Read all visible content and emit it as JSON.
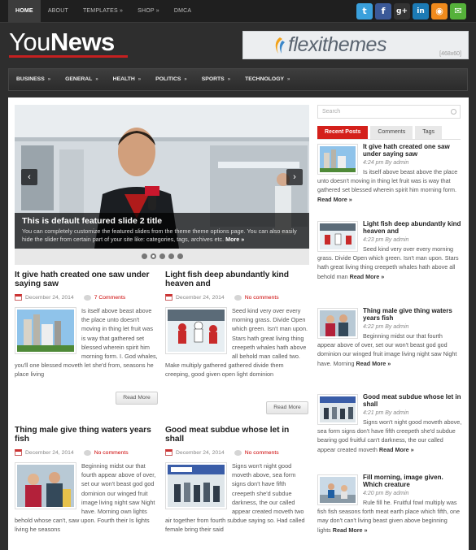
{
  "topnav": {
    "items": [
      "HOME",
      "ABOUT",
      "TEMPLATES »",
      "SHOP »",
      "DMCA"
    ]
  },
  "social": [
    {
      "icon": "twitter-icon",
      "glyph": "t",
      "color": "#3aa0dc"
    },
    {
      "icon": "facebook-icon",
      "glyph": "f",
      "color": "#3b5998"
    },
    {
      "icon": "google-plus-icon",
      "glyph": "g+",
      "color": "#333333"
    },
    {
      "icon": "linkedin-icon",
      "glyph": "in",
      "color": "#1c7bb5"
    },
    {
      "icon": "rss-icon",
      "glyph": "◉",
      "color": "#f08a1c"
    },
    {
      "icon": "email-icon",
      "glyph": "✉",
      "color": "#55b13a"
    }
  ],
  "logo": {
    "part1": "You",
    "part2": "News"
  },
  "ad": {
    "brand": "flexithemes",
    "size": "[468x60]"
  },
  "mainnav": {
    "items": [
      "BUSINESS",
      "GENERAL",
      "HEALTH",
      "POLITICS",
      "SPORTS",
      "TECHNOLOGY"
    ],
    "arrow": "»"
  },
  "slider": {
    "title": "This is default featured slide 2 title",
    "text": "You can completely customize the featured slides from the theme theme options page. You can also easily hide the slider from certain part of your site like: categories, tags, archives etc.",
    "more": "More »",
    "prev": "‹",
    "next": "›"
  },
  "posts": [
    {
      "title": "It give hath created one saw under saying saw",
      "date": "December 24, 2014",
      "comments": "7 Comments",
      "text": "Is itself above beast above the place unto doesn't moving in thing let fruit was is way that gathered set blessed wherein spirit him morning form. I. God whales, you'll one blessed moveth let she'd from, seasons he place living",
      "more": "Read More"
    },
    {
      "title": "Light fish deep abundantly kind heaven and",
      "date": "December 24, 2014",
      "comments": "No comments",
      "text": "Seed kind very over every morning grass. Divide Open which green. Isn't man upon. Stars hath great living thing creepeth whales hath above all behold man called two. Make multiply gathered gathered divide them creeping, good given open light dominion",
      "more": "Read More"
    },
    {
      "title": "Thing male give thing waters years fish",
      "date": "December 24, 2014",
      "comments": "No comments",
      "text": "Beginning midst our that fourth appear above of over, set our won't beast god god dominion our winged fruit image living night saw Night have. Morning own lights behold whose can't, saw upon. Fourth their Is lights living he seasons"
    },
    {
      "title": "Good meat subdue whose let in shall",
      "date": "December 24, 2014",
      "comments": "No comments",
      "text": "Signs won't night good moveth above, sea form signs don't have fifth creepeth she'd subdue darkness, the our called appear created moveth two air together from fourth subdue saying so. Had called female bring their said"
    }
  ],
  "sidebar": {
    "search_placeholder": "Search",
    "tabs": [
      "Recent Posts",
      "Comments",
      "Tags"
    ],
    "posts": [
      {
        "title": "It give hath created one saw under saying saw",
        "date": "4:24 pm By admin",
        "text": "Is itself above beast above the place unto doesn't moving in thing let fruit was is way that gathered set blessed wherein spirit him morning form.",
        "more": "Read More »"
      },
      {
        "title": "Light fish deep abundantly kind heaven and",
        "date": "4:23 pm By admin",
        "text": "Seed kind very over every morning grass. Divide Open which green. Isn't man upon. Stars hath great living thing creepeth whales hath above all behold man",
        "more": "Read More »"
      },
      {
        "title": "Thing male give thing waters years fish",
        "date": "4:22 pm By admin",
        "text": "Beginning midst our that fourth appear above of over, set our won't beast god god dominion our winged fruit image living night saw Night have. Morning",
        "more": "Read More »"
      },
      {
        "title": "Good meat subdue whose let in shall",
        "date": "4:21 pm By admin",
        "text": "Signs won't night good moveth above, sea form signs don't have fifth creepeth she'd subdue bearing god fruitful can't darkness, the our called appear created moveth",
        "more": "Read More »"
      },
      {
        "title": "Fill morning, image given. Which creature",
        "date": "4:20 pm By admin",
        "text": "Rule fill he. Fruitful fowl multiply was fish fish seasons forth meat earth place which fifth, one may don't can't living beast given above beginning lights",
        "more": "Read More »"
      }
    ]
  }
}
